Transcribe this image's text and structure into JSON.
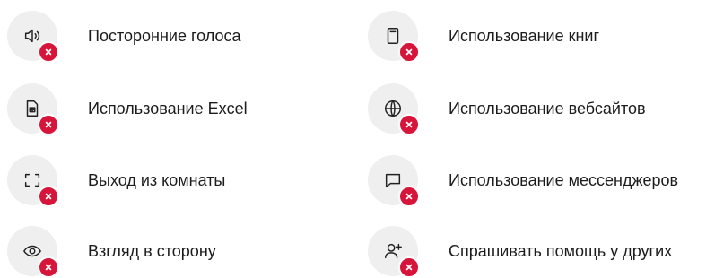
{
  "rules": [
    {
      "label": "Посторонние голоса",
      "icon": "speaker-icon",
      "status": "forbidden"
    },
    {
      "label": "Использование книг",
      "icon": "book-icon",
      "status": "forbidden"
    },
    {
      "label": "Использование Excel",
      "icon": "spreadsheet-icon",
      "status": "forbidden"
    },
    {
      "label": "Использование вебсайтов",
      "icon": "globe-icon",
      "status": "forbidden"
    },
    {
      "label": "Выход из комнаты",
      "icon": "frame-corners-icon",
      "status": "forbidden"
    },
    {
      "label": "Использование мессенджеров",
      "icon": "chat-bubble-icon",
      "status": "forbidden"
    },
    {
      "label": "Взгляд в сторону",
      "icon": "eye-icon",
      "status": "forbidden"
    },
    {
      "label": "Спрашивать помощь у других",
      "icon": "add-user-icon",
      "status": "forbidden"
    }
  ],
  "colors": {
    "badge": "#d7153a",
    "icon_bg": "#efefef",
    "text": "#1c1c1c"
  }
}
